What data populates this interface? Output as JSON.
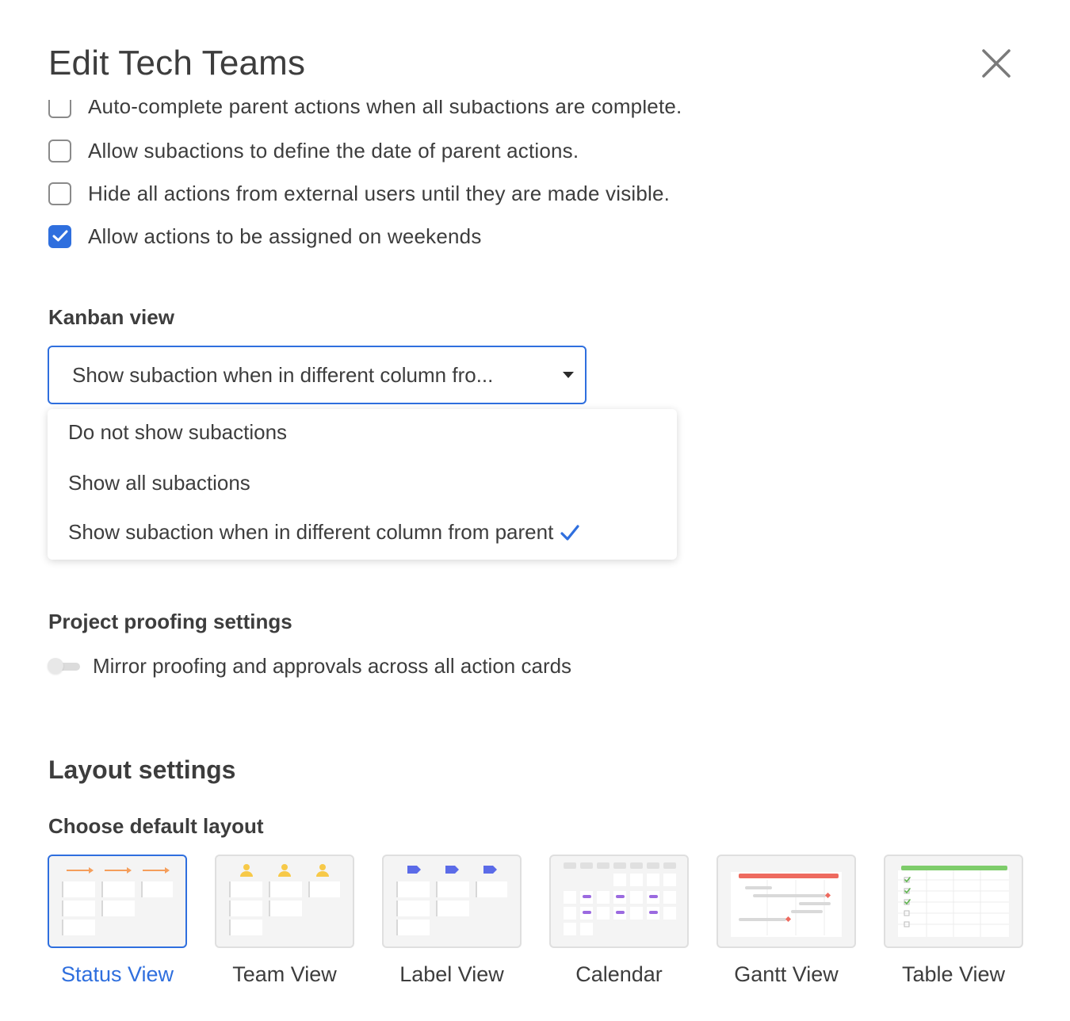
{
  "dialog": {
    "title": "Edit Tech Teams"
  },
  "checkboxes": [
    {
      "label": "Auto-complete parent actions when all subactions are complete.",
      "checked": false
    },
    {
      "label": "Allow subactions to define the date of parent actions.",
      "checked": false
    },
    {
      "label": "Hide all actions from external users until they are made visible.",
      "checked": false
    },
    {
      "label": "Allow actions to be assigned on weekends",
      "checked": true
    }
  ],
  "kanban": {
    "label": "Kanban view",
    "selected_value": "Show subaction when in different column fro...",
    "options": [
      "Do not show subactions",
      "Show all subactions",
      "Show subaction when in different column from parent"
    ],
    "selected_index": 2
  },
  "proofing": {
    "label": "Project proofing settings",
    "toggle_label": "Mirror proofing and approvals across all action cards",
    "enabled": false
  },
  "layout_settings": {
    "heading": "Layout settings",
    "choose_label": "Choose default layout",
    "options": [
      {
        "label": "Status View",
        "selected": true,
        "icon": "status-view-thumbnail"
      },
      {
        "label": "Team View",
        "selected": false,
        "icon": "team-view-thumbnail"
      },
      {
        "label": "Label View",
        "selected": false,
        "icon": "label-view-thumbnail"
      },
      {
        "label": "Calendar",
        "selected": false,
        "icon": "calendar-view-thumbnail"
      },
      {
        "label": "Gantt View",
        "selected": false,
        "icon": "gantt-view-thumbnail"
      },
      {
        "label": "Table View",
        "selected": false,
        "icon": "table-view-thumbnail"
      }
    ]
  },
  "colors": {
    "accent": "#2f6fde",
    "status_arrow": "#f59e5b",
    "team_person": "#f7c948",
    "label_tag": "#5b6be8",
    "calendar_event": "#9b6ae0",
    "gantt_bar": "#ee6a5f",
    "table_header": "#7dcc6a"
  }
}
